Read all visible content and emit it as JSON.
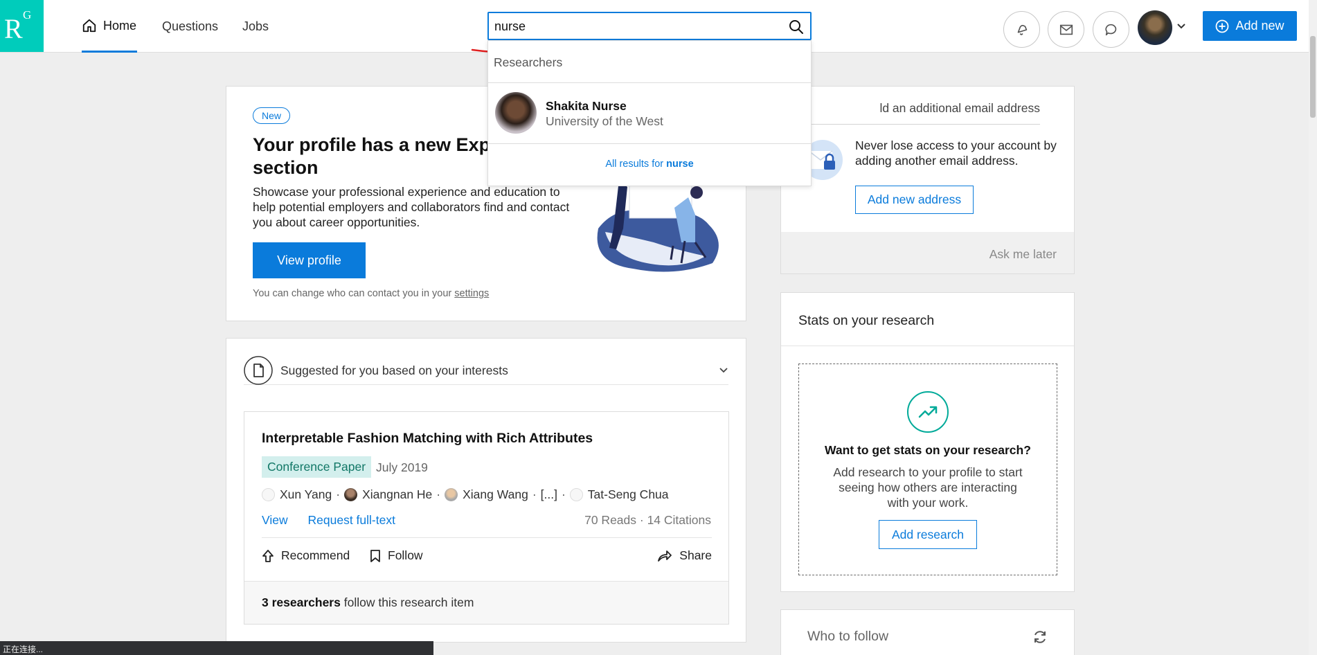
{
  "logo": {
    "r": "R",
    "g": "G"
  },
  "nav": {
    "home": "Home",
    "questions": "Questions",
    "jobs": "Jobs"
  },
  "search": {
    "value": "nurse"
  },
  "header": {
    "add_new": "Add new"
  },
  "dropdown": {
    "section": "Researchers",
    "result": {
      "name": "Shakita Nurse",
      "institution": "University of the West"
    },
    "all_results_prefix": "All results for",
    "all_results_term": "nurse"
  },
  "profile_card": {
    "badge": "New",
    "title": "Your profile has a new Expe section",
    "description": "Showcase your professional experience and education to help potential employers and collaborators find and contact you about career opportunities.",
    "button": "View profile",
    "note": "You can change who can contact you in your",
    "note_link": "settings"
  },
  "suggested": {
    "title": "Suggested for you based on your interests",
    "paper": {
      "title": "Interpretable Fashion Matching with Rich Attributes",
      "type": "Conference Paper",
      "date": "July 2019",
      "authors": [
        "Xun Yang",
        "Xiangnan He",
        "Xiang Wang",
        "[...]",
        "Tat-Seng Chua"
      ],
      "link_view": "View",
      "link_request": "Request full-text",
      "stats": "70 Reads · 14 Citations",
      "recommend": "Recommend",
      "follow": "Follow",
      "share": "Share",
      "foot_bold": "3 researchers",
      "foot_rest": "follow this research item"
    }
  },
  "email_card": {
    "title": "ld an additional email address",
    "text": "Never lose access to your account by adding another email address.",
    "button": "Add new address",
    "ask_later": "Ask me later"
  },
  "stats_card": {
    "title": "Stats on your research",
    "question": "Want to get stats on your research?",
    "description": "Add research to your profile to start seeing how others are interacting with your work.",
    "button": "Add research"
  },
  "follow_card": {
    "title": "Who to follow"
  },
  "statusbar": {
    "text": "正在连接..."
  },
  "colors": {
    "accent": "#0a7bdb",
    "brand": "#00ccbb",
    "teal": "#00aa99"
  }
}
